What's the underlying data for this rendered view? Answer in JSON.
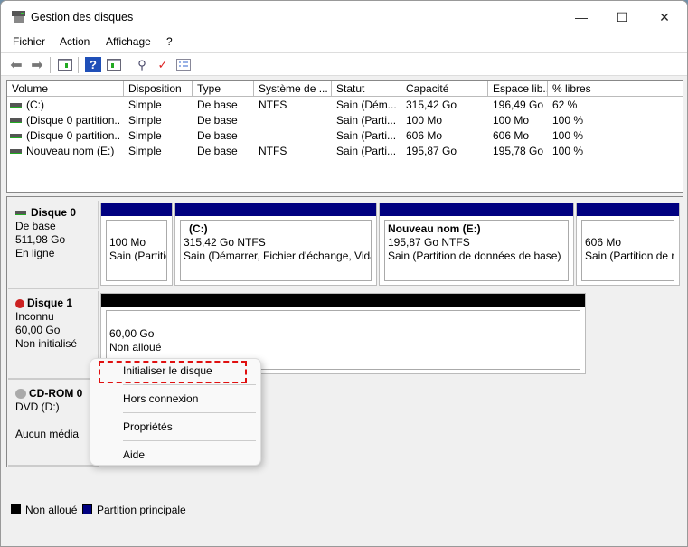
{
  "window": {
    "title": "Gestion des disques",
    "minimize": "—",
    "maximize": "☐",
    "close": "✕"
  },
  "menu": [
    "Fichier",
    "Action",
    "Affichage",
    "?"
  ],
  "toolbar": [
    "back-icon",
    "forward-icon",
    "show-hide-console-tree-icon",
    "help-icon",
    "show-action-pane-icon",
    "connect-icon",
    "check-icon",
    "properties-icon"
  ],
  "columns": [
    "Volume",
    "Disposition",
    "Type",
    "Système de ...",
    "Statut",
    "Capacité",
    "Espace lib...",
    "% libres"
  ],
  "rows": [
    [
      "(C:)",
      "Simple",
      "De base",
      "NTFS",
      "Sain (Dém...",
      "315,42 Go",
      "196,49 Go",
      "62 %"
    ],
    [
      "(Disque 0 partition...",
      "Simple",
      "De base",
      "",
      "Sain (Parti...",
      "100 Mo",
      "100 Mo",
      "100 %"
    ],
    [
      "(Disque 0 partition...",
      "Simple",
      "De base",
      "",
      "Sain (Parti...",
      "606 Mo",
      "606 Mo",
      "100 %"
    ],
    [
      "Nouveau nom (E:)",
      "Simple",
      "De base",
      "NTFS",
      "Sain (Parti...",
      "195,87 Go",
      "195,78 Go",
      "100 %"
    ]
  ],
  "disk0": {
    "name": "Disque 0",
    "type": "De base",
    "size": "511,98 Go",
    "status": "En ligne",
    "partitions": [
      {
        "title": "",
        "size": "100 Mo",
        "status": "Sain (Partitio"
      },
      {
        "title": "(C:)",
        "size": "315,42 Go NTFS",
        "status": "Sain (Démarrer, Fichier d'échange, Vidage"
      },
      {
        "title": "Nouveau nom  (E:)",
        "size": "195,87 Go NTFS",
        "status": "Sain (Partition de données de base)"
      },
      {
        "title": "",
        "size": "606 Mo",
        "status": "Sain (Partition de re"
      }
    ]
  },
  "disk1": {
    "name": "Disque 1",
    "type": "Inconnu",
    "size": "60,00 Go",
    "status": "Non initialisé",
    "part_size": "60,00 Go",
    "part_status": "Non alloué"
  },
  "cdrom": {
    "name": "CD-ROM 0",
    "type": "DVD (D:)",
    "status": "Aucun média"
  },
  "legend": [
    {
      "label": "Non alloué",
      "color": "#000000"
    },
    {
      "label": "Partition principale",
      "color": "#000080"
    }
  ],
  "context_menu": [
    "Initialiser le disque",
    "Hors connexion",
    "Propriétés",
    "Aide"
  ],
  "colors": {
    "primary_partition": "#000080",
    "unallocated": "#000000",
    "highlight": "#e01010"
  }
}
